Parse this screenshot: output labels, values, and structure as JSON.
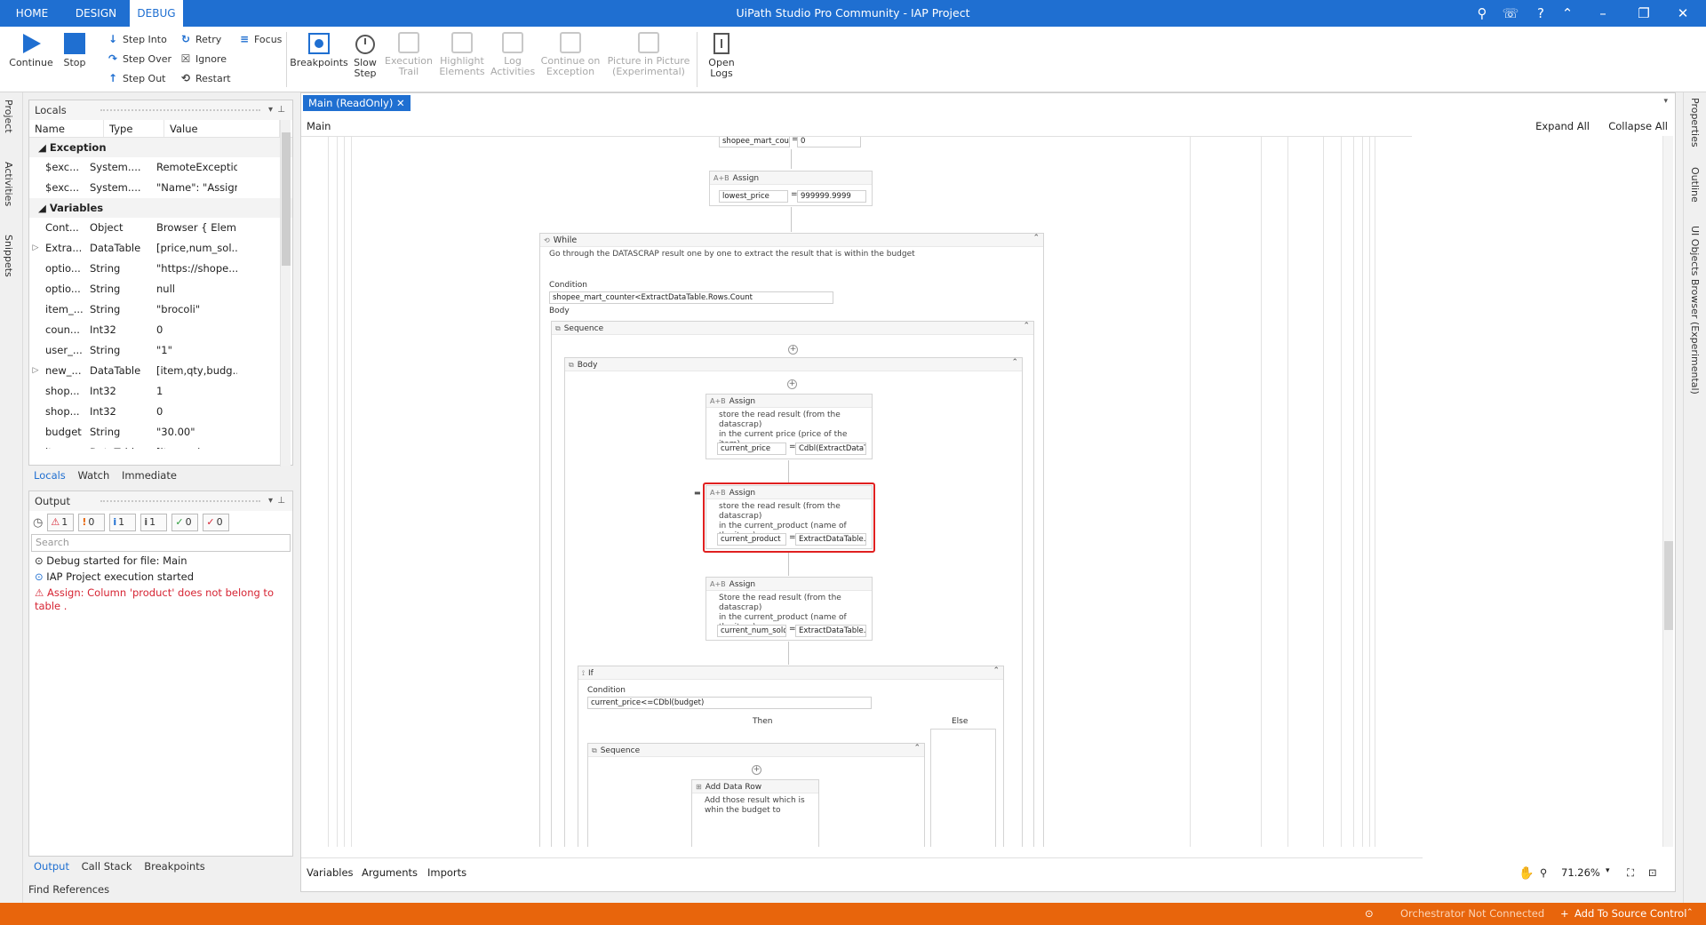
{
  "titlebar": {
    "tabs": [
      "HOME",
      "DESIGN",
      "DEBUG"
    ],
    "active_tab": "DEBUG",
    "title": "UiPath Studio Pro Community - IAP Project"
  },
  "ribbon": {
    "continue": "Continue",
    "stop": "Stop",
    "step_into": "Step Into",
    "step_over": "Step Over",
    "step_out": "Step Out",
    "retry": "Retry",
    "ignore": "Ignore",
    "restart": "Restart",
    "focus": "Focus",
    "breakpoints": "Breakpoints",
    "slow_step_1": "Slow",
    "slow_step_2": "Step",
    "execution_trail_1": "Execution",
    "execution_trail_2": "Trail",
    "highlight_1": "Highlight",
    "highlight_2": "Elements",
    "log_1": "Log",
    "log_2": "Activities",
    "continue_exc_1": "Continue on",
    "continue_exc_2": "Exception",
    "pip_1": "Picture in Picture",
    "pip_2": "(Experimental)",
    "open_logs_1": "Open",
    "open_logs_2": "Logs"
  },
  "left_strip": [
    "Project",
    "Activities",
    "Snippets"
  ],
  "locals": {
    "title": "Locals",
    "columns": [
      "Name",
      "Type",
      "Value"
    ],
    "group_exception": "Exception",
    "exception_rows": [
      {
        "name": "$exc...",
        "type": "System....",
        "value": "RemoteException"
      },
      {
        "name": "$exc...",
        "type": "System....",
        "value": " \"Name\": \"Assigr"
      }
    ],
    "group_variables": "Variables",
    "variable_rows": [
      {
        "exp": "",
        "name": "Cont...",
        "type": "Object",
        "value": "Browser { Elem..."
      },
      {
        "exp": "▷",
        "name": "Extra...",
        "type": "DataTable",
        "value": "[price,num_sol..."
      },
      {
        "exp": "",
        "name": "optio...",
        "type": "String",
        "value": "\"https://shope..."
      },
      {
        "exp": "",
        "name": "optio...",
        "type": "String",
        "value": "null"
      },
      {
        "exp": "",
        "name": "item_...",
        "type": "String",
        "value": "\"brocoli\""
      },
      {
        "exp": "",
        "name": "coun...",
        "type": "Int32",
        "value": "0"
      },
      {
        "exp": "",
        "name": "user_...",
        "type": "String",
        "value": "\"1\""
      },
      {
        "exp": "▷",
        "name": "new_...",
        "type": "DataTable",
        "value": "[item,qty,budg..."
      },
      {
        "exp": "",
        "name": "shop...",
        "type": "Int32",
        "value": "1"
      },
      {
        "exp": "",
        "name": "shop...",
        "type": "Int32",
        "value": "0"
      },
      {
        "exp": "",
        "name": "budget",
        "type": "String",
        "value": "\"30.00\""
      },
      {
        "exp": "▷",
        "name": "item_...",
        "type": "DataTable",
        "value": "[item,price,nu..."
      }
    ],
    "tabs": [
      "Locals",
      "Watch",
      "Immediate"
    ]
  },
  "output": {
    "title": "Output",
    "filters": [
      {
        "icon": "⚠",
        "count": "1",
        "color": "#d62433"
      },
      {
        "icon": "!",
        "count": "0",
        "color": "#e8650c"
      },
      {
        "icon": "i",
        "count": "1",
        "color": "#1f6fd1"
      },
      {
        "icon": "i",
        "count": "1",
        "color": "#555555"
      },
      {
        "icon": "✓",
        "count": "0",
        "color": "#2a9d3a"
      },
      {
        "icon": "✓",
        "count": "0",
        "color": "#d62433"
      }
    ],
    "search_placeholder": "Search",
    "lines": [
      "Debug started for file: Main",
      "IAP Project execution started",
      "Assign: Column 'product' does not belong to table ."
    ],
    "tabs": [
      "Output",
      "Call Stack",
      "Breakpoints"
    ]
  },
  "find_references": "Find References",
  "designer": {
    "tab": "Main (ReadOnly)",
    "breadcrumb": "Main",
    "expand_all": "Expand All",
    "collapse_all": "Collapse All",
    "top_field": "shopee_mart_coun",
    "top_value": "0",
    "assign_lowest": {
      "title": "Assign",
      "to": "lowest_price",
      "value": "999999.9999"
    },
    "while": {
      "title": "While",
      "desc": "Go through the DATASCRAP result one by one to extract the result that is within the budget",
      "condition_label": "Condition",
      "condition": "shopee_mart_counter<ExtractDataTable.Rows.Count",
      "body_label": "Body"
    },
    "sequence_title": "Sequence",
    "body_title": "Body",
    "assign1": {
      "title": "Assign",
      "desc1": "store the read result (from the datascrap)",
      "desc2": "in the current price (price of the item)",
      "to": "current_price",
      "value": "Cdbl(ExtractDataTa"
    },
    "assign2": {
      "title": "Assign",
      "desc1": "store the read result (from the datascrap)",
      "desc2": "in the current_product (name of the item)",
      "to": "current_product",
      "value": "ExtractDataTable.R"
    },
    "assign3": {
      "title": "Assign",
      "desc1": "Store the read result (from the datascrap)",
      "desc2": "in the current_product (name of the item)",
      "to": "current_num_sold",
      "value": "ExtractDataTable.R"
    },
    "if": {
      "title": "If",
      "condition_label": "Condition",
      "condition": "current_price<=CDbl(budget)",
      "then": "Then",
      "else": "Else"
    },
    "inner_sequence": "Sequence",
    "add_data_row": {
      "title": "Add Data Row",
      "desc1": "Add those result which is",
      "desc2": "whin the budget to"
    },
    "bottom_tabs": [
      "Variables",
      "Arguments",
      "Imports"
    ],
    "zoom": "71.26%"
  },
  "right_strip": [
    "Properties",
    "Outline",
    "UI Objects Browser (Experimental)"
  ],
  "status": {
    "orchestrator": "Orchestrator Not Connected",
    "source_control": "Add To Source Control"
  }
}
